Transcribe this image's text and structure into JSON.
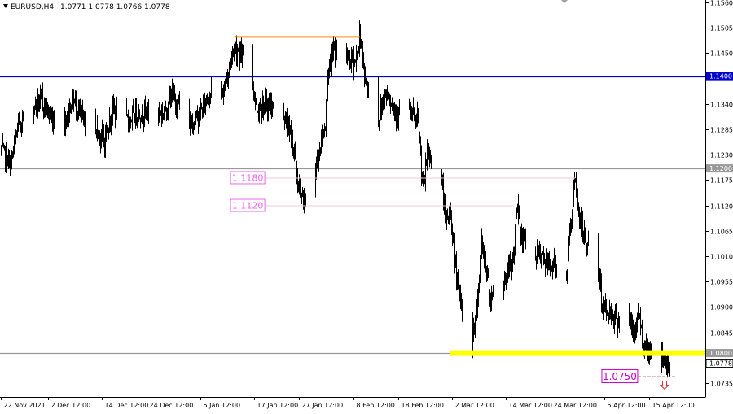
{
  "header": {
    "symbol": "EURUSD,H4",
    "ohlc": "1.0771 1.0778 1.0766 1.0778"
  },
  "chart_data": {
    "type": "candlestick",
    "ylim": [
      1.0705,
      1.1565
    ],
    "y_ticks": [
      "1.1560",
      "1.1505",
      "1.1450",
      "1.1340",
      "1.1285",
      "1.1230",
      "1.1175",
      "1.1120",
      "1.1065",
      "1.1010",
      "1.0955",
      "1.0900",
      "1.0845",
      "1.0735"
    ],
    "x_ticks": [
      "22 Nov 2021",
      "2 Dec 12:00",
      "14 Dec 12:00",
      "24 Dec 12:00",
      "5 Jan 12:00",
      "17 Jan 12:00",
      "27 Jan 12:00",
      "8 Feb 12:00",
      "18 Feb 12:00",
      "2 Mar 12:00",
      "14 Mar 12:00",
      "24 Mar 12:00",
      "5 Apr 12:00",
      "15 Apr 12:00"
    ],
    "x_range": [
      "22 Nov 2021",
      "20 Apr 2022"
    ],
    "price_path": [
      [
        "22 Nov 2021",
        1.124
      ],
      [
        "24 Nov 2021",
        1.1205
      ],
      [
        "26 Nov 2021",
        1.13
      ],
      [
        "29 Nov 2021",
        1.133
      ],
      [
        "1 Dec 2021",
        1.135
      ],
      [
        "3 Dec 2021",
        1.131
      ],
      [
        "6 Dec 2021",
        1.13
      ],
      [
        "8 Dec 2021",
        1.135
      ],
      [
        "10 Dec 2021",
        1.131
      ],
      [
        "13 Dec 2021",
        1.129
      ],
      [
        "15 Dec 2021",
        1.126
      ],
      [
        "17 Dec 2021",
        1.133
      ],
      [
        "20 Dec 2021",
        1.13
      ],
      [
        "22 Dec 2021",
        1.132
      ],
      [
        "24 Dec 2021",
        1.132
      ],
      [
        "28 Dec 2021",
        1.132
      ],
      [
        "30 Dec 2021",
        1.136
      ],
      [
        "3 Jan 2022",
        1.13
      ],
      [
        "5 Jan 2022",
        1.131
      ],
      [
        "7 Jan 2022",
        1.136
      ],
      [
        "11 Jan 2022",
        1.137
      ],
      [
        "12 Jan 2022",
        1.143
      ],
      [
        "13 Jan 2022",
        1.147
      ],
      [
        "14 Jan 2022",
        1.145
      ],
      [
        "17 Jan 2022",
        1.14
      ],
      [
        "18 Jan 2022",
        1.133
      ],
      [
        "20 Jan 2022",
        1.134
      ],
      [
        "24 Jan 2022",
        1.132
      ],
      [
        "26 Jan 2022",
        1.126
      ],
      [
        "27 Jan 2022",
        1.117
      ],
      [
        "28 Jan 2022",
        1.1125
      ],
      [
        "31 Jan 2022",
        1.12
      ],
      [
        "2 Feb 2022",
        1.129
      ],
      [
        "3 Feb 2022",
        1.14
      ],
      [
        "4 Feb 2022",
        1.146
      ],
      [
        "7 Feb 2022",
        1.144
      ],
      [
        "9 Feb 2022",
        1.143
      ],
      [
        "10 Feb 2022",
        1.149
      ],
      [
        "11 Feb 2022",
        1.14
      ],
      [
        "14 Feb 2022",
        1.131
      ],
      [
        "16 Feb 2022",
        1.137
      ],
      [
        "18 Feb 2022",
        1.132
      ],
      [
        "21 Feb 2022",
        1.132
      ],
      [
        "23 Feb 2022",
        1.13
      ],
      [
        "24 Feb 2022",
        1.115
      ],
      [
        "25 Feb 2022",
        1.124
      ],
      [
        "28 Feb 2022",
        1.119
      ],
      [
        "1 Mar 2022",
        1.108
      ],
      [
        "2 Mar 2022",
        1.111
      ],
      [
        "3 Mar 2022",
        1.102
      ],
      [
        "4 Mar 2022",
        1.092
      ],
      [
        "7 Mar 2022",
        1.082
      ],
      [
        "8 Mar 2022",
        1.09
      ],
      [
        "9 Mar 2022",
        1.104
      ],
      [
        "10 Mar 2022",
        1.099
      ],
      [
        "11 Mar 2022",
        1.092
      ],
      [
        "14 Mar 2022",
        1.096
      ],
      [
        "16 Mar 2022",
        1.1
      ],
      [
        "17 Mar 2022",
        1.112
      ],
      [
        "18 Mar 2022",
        1.105
      ],
      [
        "21 Mar 2022",
        1.102
      ],
      [
        "23 Mar 2022",
        1.1
      ],
      [
        "24 Mar 2022",
        1.099
      ],
      [
        "25 Mar 2022",
        1.099
      ],
      [
        "28 Mar 2022",
        1.097
      ],
      [
        "29 Mar 2022",
        1.11
      ],
      [
        "30 Mar 2022",
        1.117
      ],
      [
        "31 Mar 2022",
        1.108
      ],
      [
        "1 Apr 2022",
        1.105
      ],
      [
        "4 Apr 2022",
        1.098
      ],
      [
        "5 Apr 2022",
        1.091
      ],
      [
        "6 Apr 2022",
        1.089
      ],
      [
        "7 Apr 2022",
        1.089
      ],
      [
        "8 Apr 2022",
        1.087
      ],
      [
        "11 Apr 2022",
        1.088
      ],
      [
        "12 Apr 2022",
        1.083
      ],
      [
        "13 Apr 2022",
        1.09
      ],
      [
        "14 Apr 2022",
        1.082
      ],
      [
        "15 Apr 2022",
        1.081
      ],
      [
        "18 Apr 2022",
        1.079
      ],
      [
        "19 Apr 2022",
        1.078
      ],
      [
        "20 Apr 2022",
        1.0778
      ]
    ],
    "levels": [
      {
        "price": 1.14,
        "label": "1.1400",
        "color": "#0000cc"
      },
      {
        "price": 1.12,
        "label": "1.1200",
        "color": "#999999"
      },
      {
        "price": 1.08,
        "label": "1.0800",
        "color": "#999999"
      }
    ],
    "current_price": {
      "price": 1.0778,
      "label": "1.0778"
    },
    "zones": [
      {
        "kind": "resistance",
        "price": 1.1485,
        "from": "13 Jan 2022",
        "to": "10 Feb 2022",
        "color": "#ff8c00"
      },
      {
        "kind": "support",
        "price": 1.08,
        "from": "2 Mar 2022",
        "to": "20 Apr 2022",
        "color": "#ffff00"
      }
    ],
    "annotations": [
      {
        "label": "1.1180",
        "price": 1.118,
        "from": "20 Jan 2022",
        "to": "30 Mar 2022",
        "color": "#ee66ee"
      },
      {
        "label": "1.1120",
        "price": 1.112,
        "from": "20 Jan 2022",
        "to": "16 Mar 2022",
        "color": "#ee66ee"
      },
      {
        "label": "1.0750",
        "price": 1.075,
        "from": "14 Apr 2022",
        "to": "20 Apr 2022",
        "color": "#cc00cc"
      }
    ],
    "target_arrow": {
      "direction": "down",
      "color": "#e03030"
    }
  }
}
